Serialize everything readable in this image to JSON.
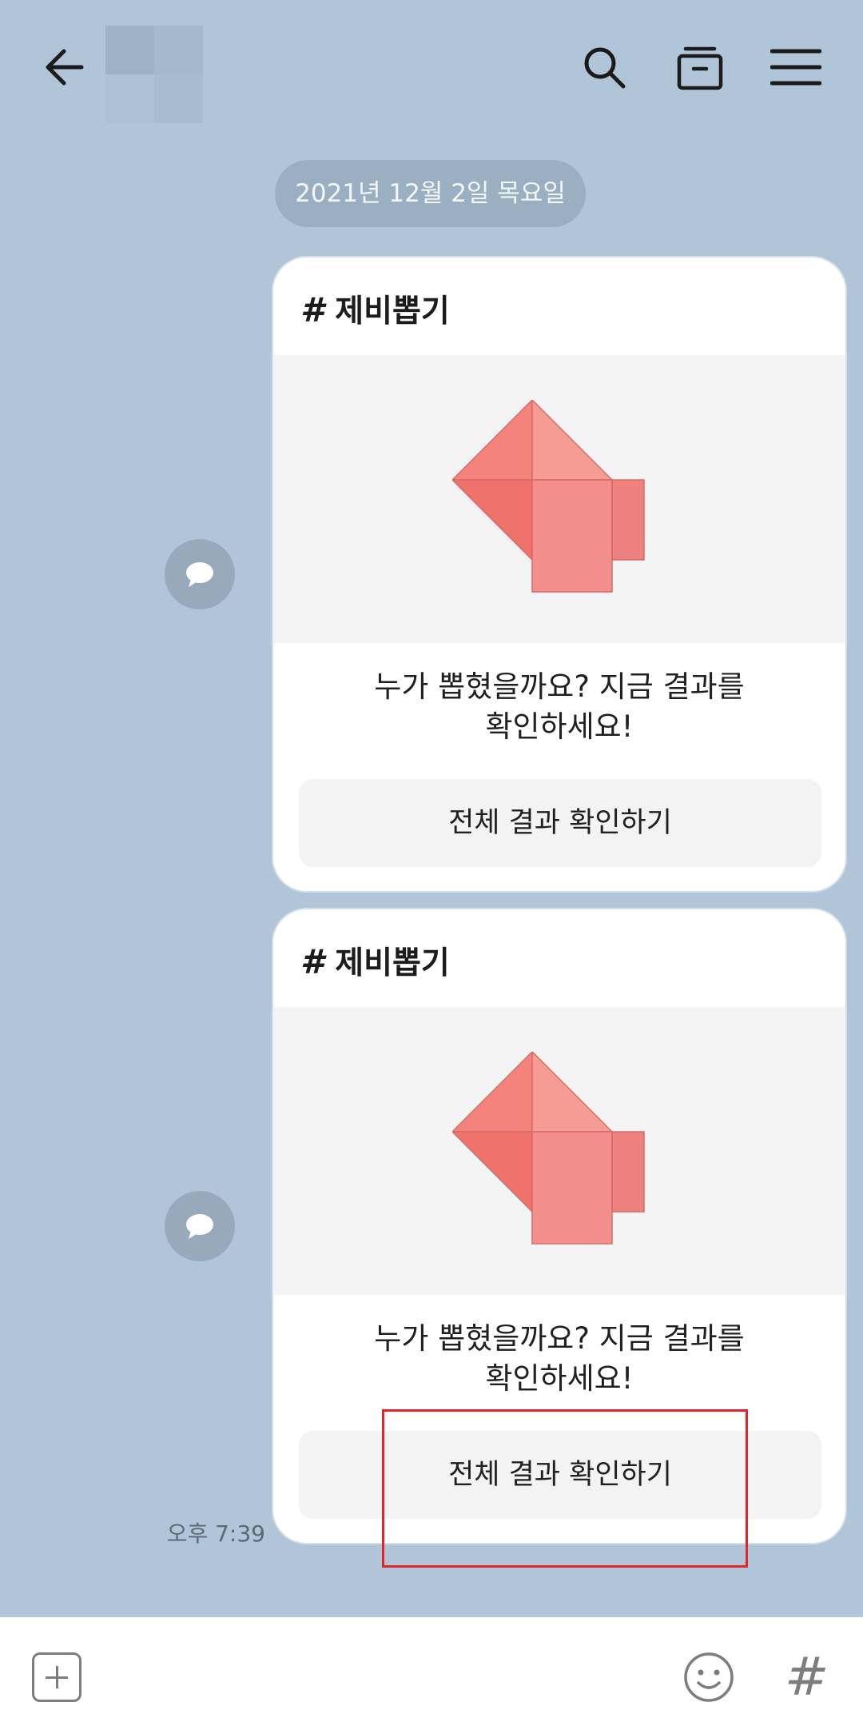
{
  "header": {
    "back_icon": "arrow-left-icon",
    "search_icon": "search-icon",
    "drawer_icon": "drawer-icon",
    "menu_icon": "hamburger-menu-icon"
  },
  "date_divider": "2021년 12월 2일 목요일",
  "cards": [
    {
      "title_hash": "#",
      "title": "제비뽑기",
      "message_line1": "누가 뽑혔을까요? 지금 결과를",
      "message_line2": "확인하세요!",
      "button_label": "전체 결과 확인하기"
    },
    {
      "title_hash": "#",
      "title": "제비뽑기",
      "message_line1": "누가 뽑혔을까요? 지금 결과를",
      "message_line2": "확인하세요!",
      "button_label": "전체 결과 확인하기"
    }
  ],
  "timestamp": "오후 7:39",
  "bottom_bar": {
    "add_icon": "plus-square-icon",
    "emoji_icon": "emoji-icon",
    "hash_label": "#"
  },
  "colors": {
    "background": "#b1c5d9",
    "illustration": "#f28b86",
    "highlight": "#e0262a"
  }
}
